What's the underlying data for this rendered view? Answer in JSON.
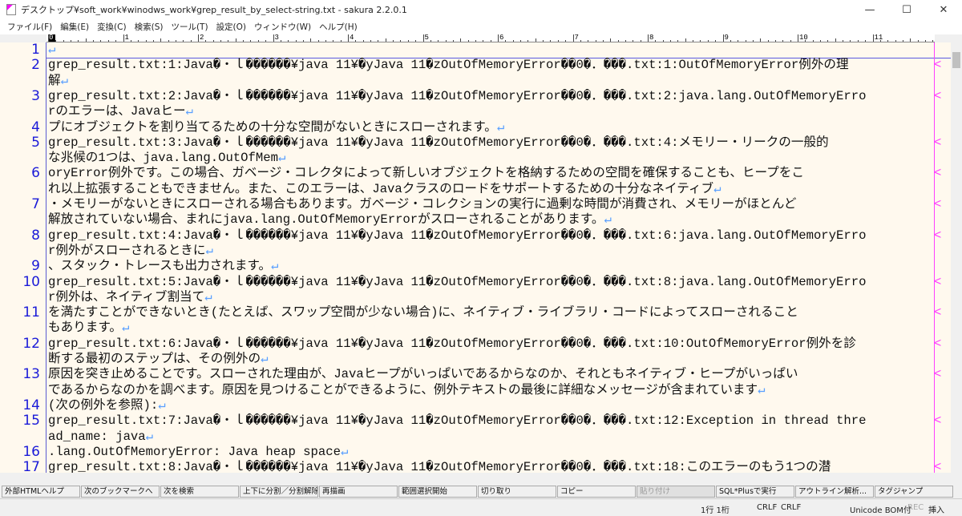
{
  "title": "デスクトップ¥soft_work¥winodws_work¥grep_result_by_select-string.txt - sakura 2.2.0.1",
  "menu": [
    "ファイル(F)",
    "編集(E)",
    "変換(C)",
    "検索(S)",
    "ツール(T)",
    "設定(O)",
    "ウィンドウ(W)",
    "ヘルプ(H)"
  ],
  "ruler": [
    "0",
    "1",
    "2",
    "3",
    "4",
    "5",
    "6",
    "7",
    "8",
    "9",
    "10",
    "11"
  ],
  "colors": {
    "editor_bg": "#fff9ee",
    "line_number": "#1a1ad8",
    "wrap_mark": "#ff40ff",
    "return_mark": "#5aa0ff"
  },
  "rows": [
    {
      "n": "1",
      "t": "",
      "ret": true
    },
    {
      "n": "2",
      "t": "grep_result.txt:1:Java�・ｌ������¥java 11¥�yJava 11�zOutOfMemoryError��0�．���.txt:1:OutOfMemoryError例外の理",
      "wrap": true
    },
    {
      "n": "",
      "t": "解",
      "ret": true
    },
    {
      "n": "3",
      "t": "grep_result.txt:2:Java�・ｌ������¥java 11¥�yJava 11�zOutOfMemoryError��0�．���.txt:2:java.lang.OutOfMemoryErro",
      "wrap": true
    },
    {
      "n": "",
      "t": "rのエラーは、Javaヒー",
      "ret": true
    },
    {
      "n": "4",
      "t": "プにオブジェクトを割り当てるための十分な空間がないときにスローされます。",
      "ret": true
    },
    {
      "n": "5",
      "t": "grep_result.txt:3:Java�・ｌ������¥java 11¥�yJava 11�zOutOfMemoryError��0�．���.txt:4:メモリー・リークの一般的",
      "wrap": true
    },
    {
      "n": "",
      "t": "な兆候の1つは、java.lang.OutOfMem",
      "ret": true
    },
    {
      "n": "6",
      "t": "oryError例外です。この場合、ガベージ・コレクタによって新しいオブジェクトを格納するための空間を確保することも、ヒープをこ",
      "wrap": true
    },
    {
      "n": "",
      "t": "れ以上拡張することもできません。また、このエラーは、Javaクラスのロードをサポートするための十分なネイティブ",
      "ret": true
    },
    {
      "n": "7",
      "t": "・メモリーがないときにスローされる場合もあります。ガベージ・コレクションの実行に過剰な時間が消費され、メモリーがほとんど",
      "wrap": true
    },
    {
      "n": "",
      "t": "解放されていない場合、まれにjava.lang.OutOfMemoryErrorがスローされることがあります。",
      "ret": true
    },
    {
      "n": "8",
      "t": "grep_result.txt:4:Java�・ｌ������¥java 11¥�yJava 11�zOutOfMemoryError��0�．���.txt:6:java.lang.OutOfMemoryErro",
      "wrap": true
    },
    {
      "n": "",
      "t": "r例外がスローされるときに",
      "ret": true
    },
    {
      "n": "9",
      "t": "、スタック・トレースも出力されます。",
      "ret": true
    },
    {
      "n": "10",
      "t": "grep_result.txt:5:Java�・ｌ������¥java 11¥�yJava 11�zOutOfMemoryError��0�．���.txt:8:java.lang.OutOfMemoryErro",
      "wrap": true
    },
    {
      "n": "",
      "t": "r例外は、ネイティブ割当て",
      "ret": true
    },
    {
      "n": "11",
      "t": "を満たすことができないとき(たとえば、スワップ空間が少ない場合)に、ネイティブ・ライブラリ・コードによってスローされること",
      "wrap": true
    },
    {
      "n": "",
      "t": "もあります。",
      "ret": true
    },
    {
      "n": "12",
      "t": "grep_result.txt:6:Java�・ｌ������¥java 11¥�yJava 11�zOutOfMemoryError��0�．���.txt:10:OutOfMemoryError例外を診",
      "wrap": true
    },
    {
      "n": "",
      "t": "断する最初のステップは、その例外の",
      "ret": true
    },
    {
      "n": "13",
      "t": "原因を突き止めることです。スローされた理由が、Javaヒープがいっぱいであるからなのか、それともネイティブ・ヒープがいっぱい",
      "wrap": true
    },
    {
      "n": "",
      "t": "であるからなのかを調べます。原因を見つけることができるように、例外テキストの最後に詳細なメッセージが含まれています",
      "ret": true
    },
    {
      "n": "14",
      "t": "(次の例外を参照):",
      "ret": true
    },
    {
      "n": "15",
      "t": "grep_result.txt:7:Java�・ｌ������¥java 11¥�yJava 11�zOutOfMemoryError��0�．���.txt:12:Exception in thread thre",
      "wrap": true
    },
    {
      "n": "",
      "t": "ad_name: java",
      "ret": true
    },
    {
      "n": "16",
      "t": ".lang.OutOfMemoryError: Java heap space",
      "ret": true
    },
    {
      "n": "17",
      "t": "grep_result.txt:8:Java�・ｌ������¥java 11¥�yJava 11�zOutOfMemoryError��0�．���.txt:18:このエラーのもう1つの潜",
      "wrap": true
    }
  ],
  "fkeys": [
    {
      "label": "外部HTMLヘルプ"
    },
    {
      "label": "次のブックマークへ"
    },
    {
      "label": "次を検索"
    },
    {
      "label": "上下に分割／分割解除"
    },
    {
      "label": "再描画"
    },
    {
      "label": "範囲選択開始"
    },
    {
      "label": "切り取り"
    },
    {
      "label": "コピー"
    },
    {
      "label": "貼り付け",
      "disabled": true
    },
    {
      "label": "SQL*Plusで実行"
    },
    {
      "label": "アウトライン解析..."
    },
    {
      "label": "タグジャンプ"
    }
  ],
  "status": {
    "position": "1行 1桁",
    "eol1": "CRLF",
    "eol2": "CRLF",
    "encoding": "Unicode BOM付",
    "rec": "REC",
    "mode": "挿入"
  },
  "marks": {
    "return": "↵",
    "wrap": "<"
  }
}
